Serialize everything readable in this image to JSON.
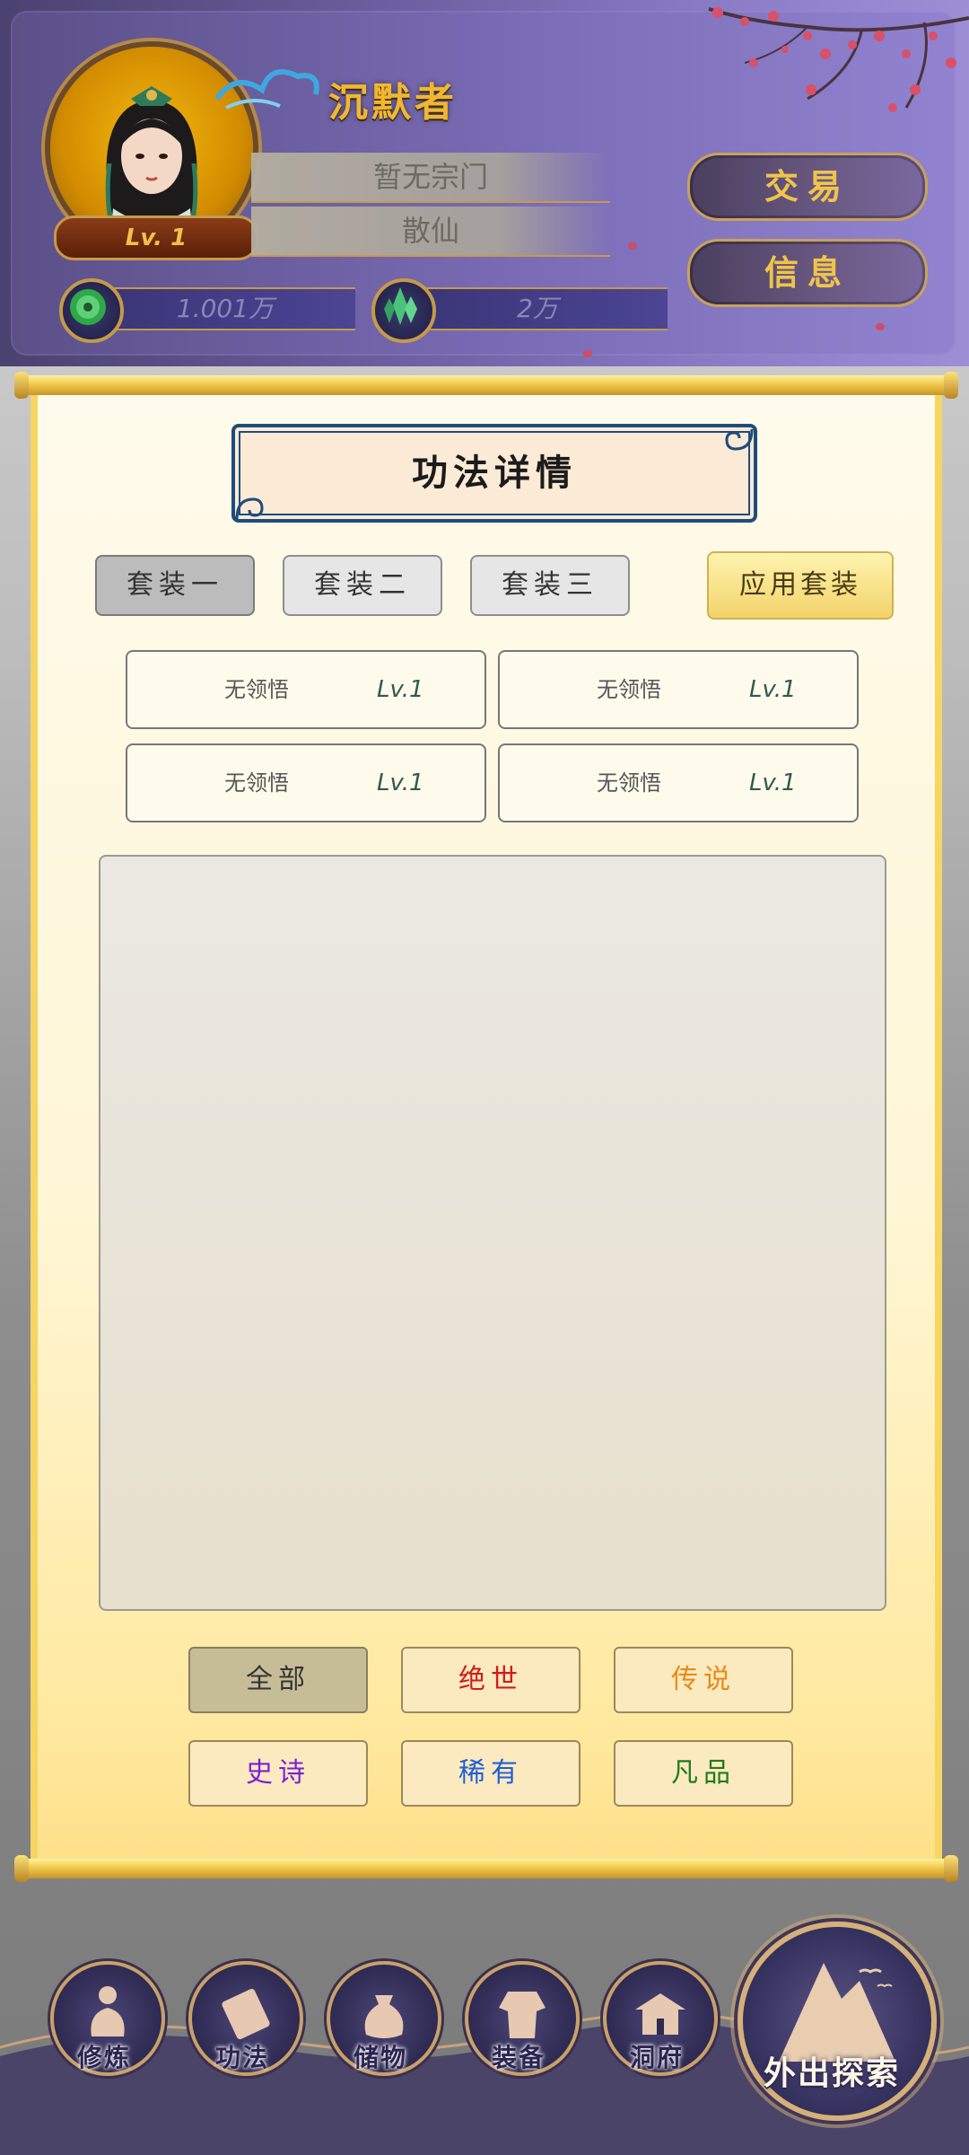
{
  "player": {
    "name": "沉默者",
    "level": "Lv. 1",
    "sect": "暂无宗门",
    "title": "散仙"
  },
  "currencies": [
    {
      "icon": "jade-coin-icon",
      "amount": "1.001万"
    },
    {
      "icon": "spirit-crystal-icon",
      "amount": "2万"
    }
  ],
  "header_buttons": {
    "trade": "交易",
    "info": "信息"
  },
  "panel": {
    "title": "功法详情",
    "sets": [
      "套装一",
      "套装二",
      "套装三"
    ],
    "active_set": 0,
    "apply_label": "应用套装",
    "slots": [
      {
        "name": "无领悟",
        "level": "Lv.1"
      },
      {
        "name": "无领悟",
        "level": "Lv.1"
      },
      {
        "name": "无领悟",
        "level": "Lv.1"
      },
      {
        "name": "无领悟",
        "level": "Lv.1"
      }
    ],
    "filters": [
      {
        "label": "全部",
        "color": "#333333"
      },
      {
        "label": "绝世",
        "color": "#d11a1a"
      },
      {
        "label": "传说",
        "color": "#e98a1a"
      },
      {
        "label": "史诗",
        "color": "#7b1fd6"
      },
      {
        "label": "稀有",
        "color": "#1f5fd6"
      },
      {
        "label": "凡品",
        "color": "#1f7a1f"
      }
    ],
    "active_filter": 0
  },
  "nav": {
    "items": [
      {
        "label": "修炼",
        "icon": "cultivate-icon"
      },
      {
        "label": "功法",
        "icon": "scroll-icon"
      },
      {
        "label": "储物",
        "icon": "bag-icon"
      },
      {
        "label": "装备",
        "icon": "armor-icon"
      },
      {
        "label": "洞府",
        "icon": "cave-house-icon"
      }
    ],
    "explore": {
      "label": "外出探索",
      "icon": "mountain-icon"
    }
  }
}
